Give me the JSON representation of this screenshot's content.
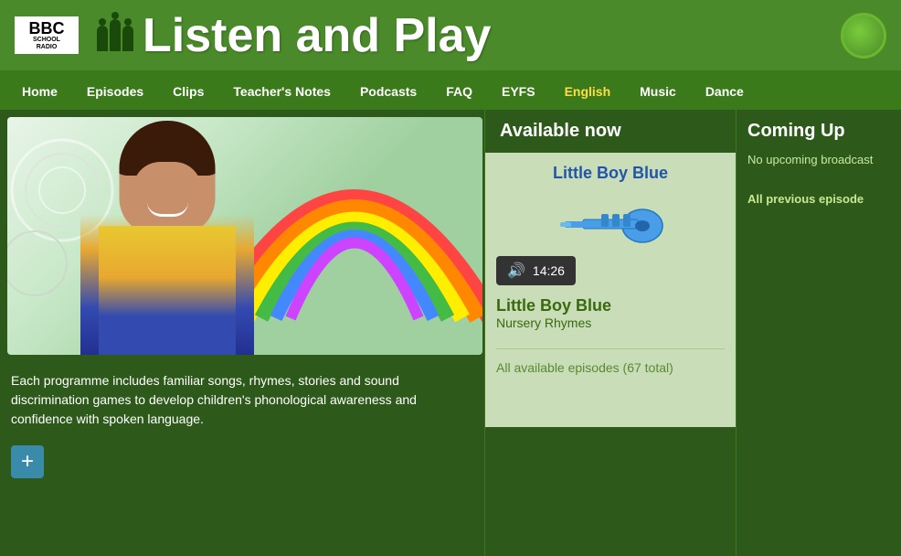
{
  "header": {
    "bbc_line1": "BBC",
    "bbc_line2": "SCHOOL\nRADIO",
    "page_title": "Listen and Play"
  },
  "nav": {
    "items": [
      {
        "label": "Home",
        "id": "home"
      },
      {
        "label": "Episodes",
        "id": "episodes"
      },
      {
        "label": "Clips",
        "id": "clips"
      },
      {
        "label": "Teacher's Notes",
        "id": "teachers-notes"
      },
      {
        "label": "Podcasts",
        "id": "podcasts"
      },
      {
        "label": "FAQ",
        "id": "faq"
      },
      {
        "label": "EYFS",
        "id": "eyfs"
      },
      {
        "label": "English",
        "id": "english",
        "highlight": true
      },
      {
        "label": "Music",
        "id": "music"
      },
      {
        "label": "Dance",
        "id": "dance"
      }
    ]
  },
  "main": {
    "description": "Each programme includes familiar songs, rhymes, stories and sound discrimination games to develop children's phonological awareness and confidence with spoken language.",
    "available_now": {
      "heading": "Available now",
      "episode_link": "Little Boy Blue",
      "duration": "14:26",
      "episode_name": "Little Boy Blue",
      "episode_category": "Nursery Rhymes",
      "all_episodes_label": "All available episodes",
      "all_episodes_count": "(67 total)"
    },
    "coming_up": {
      "heading": "Coming Up",
      "no_upcoming": "No upcoming broadcast",
      "all_previous_label": "All previous episode"
    },
    "add_button_label": "+"
  }
}
